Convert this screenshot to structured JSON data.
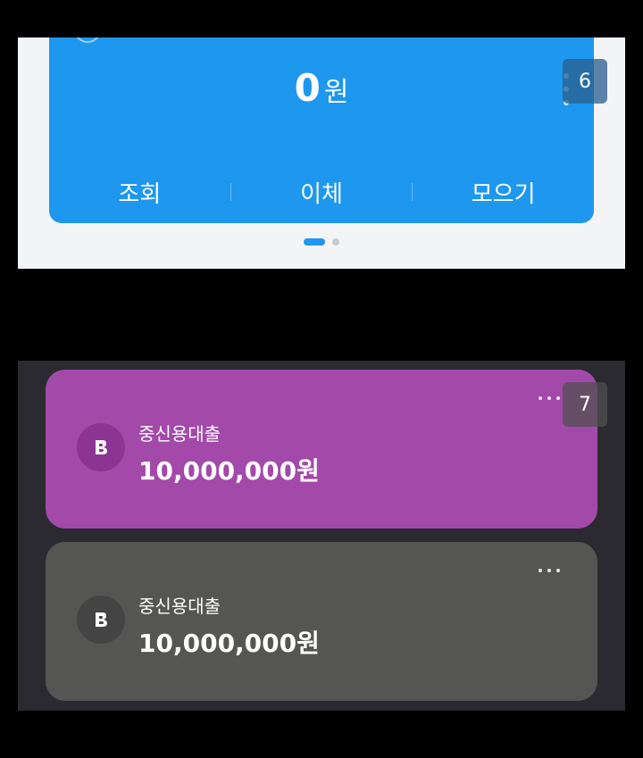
{
  "panel_top": {
    "balance": {
      "amount": "0",
      "unit": "원"
    },
    "actions": [
      "조회",
      "이체",
      "모으기"
    ],
    "pager": {
      "pages": 2,
      "current": 1
    },
    "badge": "6"
  },
  "panel_bottom": {
    "badge": "7",
    "cards": [
      {
        "name": "중신용대출",
        "amount": "10,000,000원",
        "color": "#a349a9"
      },
      {
        "name": "중신용대출",
        "amount": "10,000,000원",
        "color": "#555654"
      }
    ]
  }
}
